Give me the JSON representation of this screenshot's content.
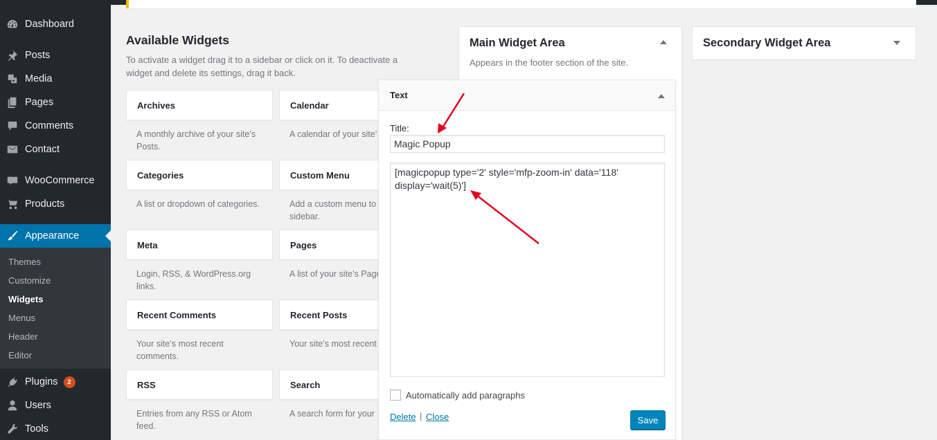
{
  "sidebar": {
    "items": [
      {
        "label": "Dashboard",
        "icon": "dashboard-icon"
      },
      {
        "label": "Posts",
        "icon": "pin-icon"
      },
      {
        "label": "Media",
        "icon": "media-icon"
      },
      {
        "label": "Pages",
        "icon": "pages-icon"
      },
      {
        "label": "Comments",
        "icon": "comment-icon"
      },
      {
        "label": "Contact",
        "icon": "mail-icon"
      },
      {
        "label": "WooCommerce",
        "icon": "woo-icon"
      },
      {
        "label": "Products",
        "icon": "cart-icon"
      },
      {
        "label": "Appearance",
        "icon": "brush-icon"
      },
      {
        "label": "Plugins",
        "icon": "plug-icon",
        "badge": "2"
      },
      {
        "label": "Users",
        "icon": "user-icon"
      },
      {
        "label": "Tools",
        "icon": "wrench-icon"
      }
    ],
    "submenu": [
      "Themes",
      "Customize",
      "Widgets",
      "Menus",
      "Header",
      "Editor"
    ]
  },
  "available": {
    "title": "Available Widgets",
    "description": "To activate a widget drag it to a sidebar or click on it. To deactivate a widget and delete its settings, drag it back.",
    "widgets": [
      {
        "name": "Archives",
        "desc": "A monthly archive of your site’s Posts."
      },
      {
        "name": "Calendar",
        "desc": "A calendar of your site’"
      },
      {
        "name": "Categories",
        "desc": "A list or dropdown of categories."
      },
      {
        "name": "Custom Menu",
        "desc": "Add a custom menu to sidebar."
      },
      {
        "name": "Meta",
        "desc": "Login, RSS, & WordPress.org links."
      },
      {
        "name": "Pages",
        "desc": "A list of your site’s Page"
      },
      {
        "name": "Recent Comments",
        "desc": "Your site’s most recent comments."
      },
      {
        "name": "Recent Posts",
        "desc": "Your site’s most recent"
      },
      {
        "name": "RSS",
        "desc": "Entries from any RSS or Atom feed."
      },
      {
        "name": "Search",
        "desc": "A search form for your"
      }
    ]
  },
  "main_area": {
    "title": "Main Widget Area",
    "description": "Appears in the footer section of the site."
  },
  "secondary_area": {
    "title": "Secondary Widget Area"
  },
  "text_widget": {
    "header": "Text",
    "title_label": "Title:",
    "title_value": "Magic Popup",
    "content_line1": "[magicpopup type='2' style='mfp-zoom-in' data='118'",
    "content_line2": "display='wait(5)']",
    "auto_paragraphs_label": "Automatically add paragraphs",
    "delete_label": "Delete",
    "separator": "|",
    "close_label": "Close",
    "save_label": "Save"
  },
  "colors": {
    "sidebar_bg": "#23282d",
    "accent": "#0073aa",
    "annotation_arrow": "#e3001b"
  }
}
